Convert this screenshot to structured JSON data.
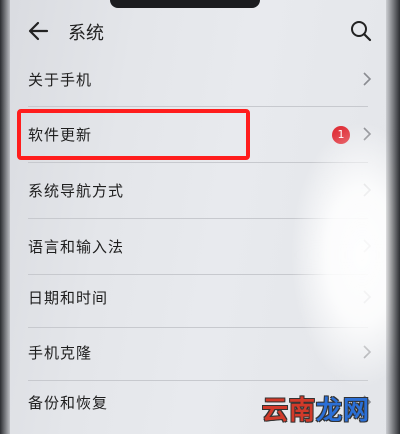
{
  "header": {
    "title": "系统",
    "back_icon": "arrow-left-icon",
    "search_icon": "search-icon"
  },
  "settings": {
    "items": [
      {
        "label": "关于手机"
      },
      {
        "label": "软件更新",
        "badge": "1"
      },
      {
        "label": "系统导航方式"
      },
      {
        "label": "语言和输入法"
      },
      {
        "label": "日期和时间"
      },
      {
        "label": "手机克隆"
      },
      {
        "label": "备份和恢复"
      }
    ]
  },
  "annotation": {
    "highlight_color": "#ff1d1d"
  },
  "watermark": {
    "text_part1": "云南",
    "text_part2": "龙网"
  },
  "colors": {
    "badge": "#e0313a",
    "text": "#1e1e1e"
  }
}
